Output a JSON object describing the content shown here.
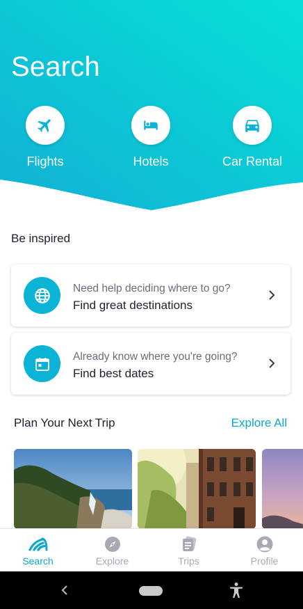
{
  "header": {
    "title": "Search"
  },
  "categories": [
    {
      "label": "Flights",
      "icon": "airplane-icon"
    },
    {
      "label": "Hotels",
      "icon": "bed-icon"
    },
    {
      "label": "Car Rental",
      "icon": "car-icon"
    }
  ],
  "inspired": {
    "title": "Be inspired",
    "cards": [
      {
        "subtitle": "Need help deciding where to go?",
        "title": "Find great destinations",
        "icon": "globe-icon"
      },
      {
        "subtitle": "Already know where you're going?",
        "title": "Find best dates",
        "icon": "calendar-icon"
      }
    ]
  },
  "plan": {
    "title": "Plan Your Next Trip",
    "link": "Explore All"
  },
  "tabs": [
    {
      "label": "Search",
      "icon": "kayak-search-icon",
      "active": true
    },
    {
      "label": "Explore",
      "icon": "compass-icon",
      "active": false
    },
    {
      "label": "Trips",
      "icon": "trips-icon",
      "active": false
    },
    {
      "label": "Profile",
      "icon": "profile-icon",
      "active": false
    }
  ],
  "colors": {
    "accent": "#0aa8cf",
    "hero_start": "#16b3d3",
    "hero_end": "#08dcd8",
    "muted": "#a9a9b3"
  }
}
